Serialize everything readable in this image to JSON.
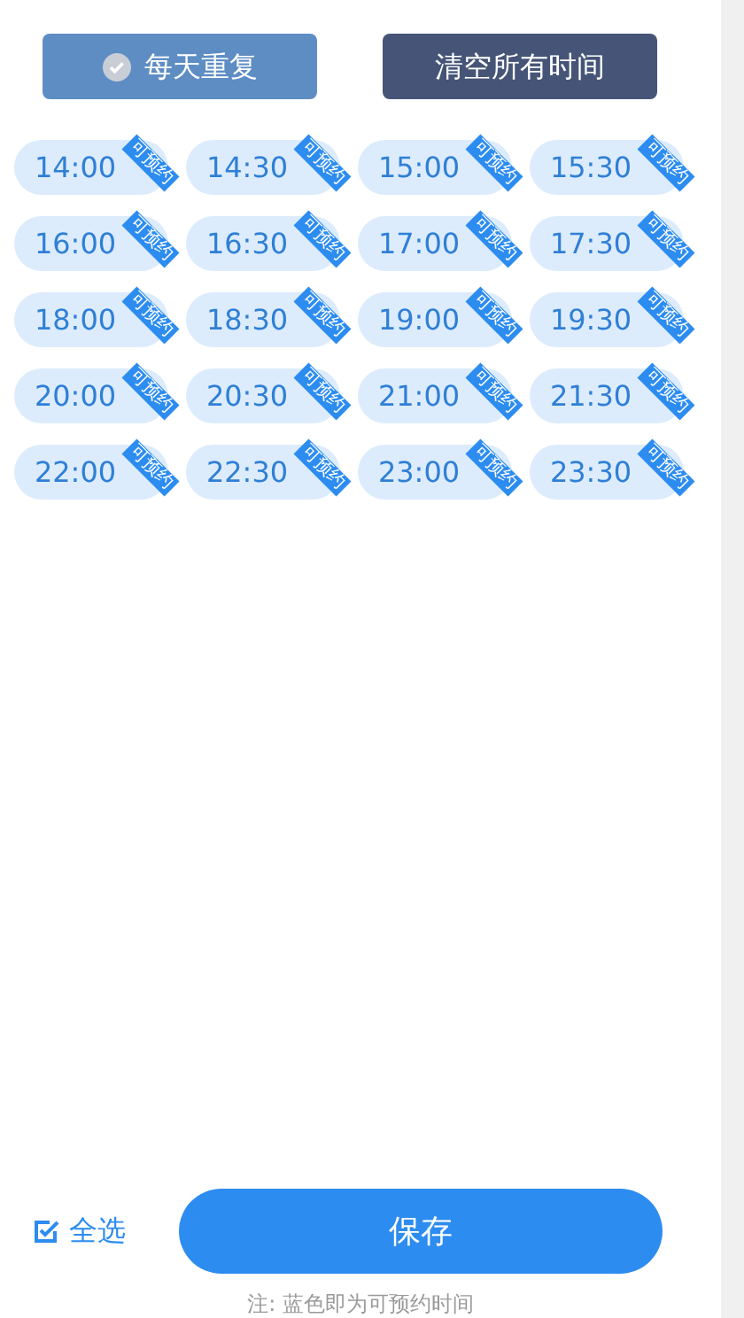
{
  "repeat_button": {
    "label": "每天重复",
    "checked": false
  },
  "clear_button": {
    "label": "清空所有时间"
  },
  "slots": [
    {
      "time": "14:00",
      "available": true,
      "badge": "可预约"
    },
    {
      "time": "14:30",
      "available": true,
      "badge": "可预约"
    },
    {
      "time": "15:00",
      "available": true,
      "badge": "可预约"
    },
    {
      "time": "15:30",
      "available": true,
      "badge": "可预约"
    },
    {
      "time": "16:00",
      "available": true,
      "badge": "可预约"
    },
    {
      "time": "16:30",
      "available": true,
      "badge": "可预约"
    },
    {
      "time": "17:00",
      "available": true,
      "badge": "可预约"
    },
    {
      "time": "17:30",
      "available": true,
      "badge": "可预约"
    },
    {
      "time": "18:00",
      "available": true,
      "badge": "可预约"
    },
    {
      "time": "18:30",
      "available": true,
      "badge": "可预约"
    },
    {
      "time": "19:00",
      "available": true,
      "badge": "可预约"
    },
    {
      "time": "19:30",
      "available": true,
      "badge": "可预约"
    },
    {
      "time": "20:00",
      "available": true,
      "badge": "可预约"
    },
    {
      "time": "20:30",
      "available": true,
      "badge": "可预约"
    },
    {
      "time": "21:00",
      "available": true,
      "badge": "可预约"
    },
    {
      "time": "21:30",
      "available": true,
      "badge": "可预约"
    },
    {
      "time": "22:00",
      "available": true,
      "badge": "可预约"
    },
    {
      "time": "22:30",
      "available": true,
      "badge": "可预约"
    },
    {
      "time": "23:00",
      "available": true,
      "badge": "可预约"
    },
    {
      "time": "23:30",
      "available": true,
      "badge": "可预约"
    }
  ],
  "select_all": {
    "label": "全选",
    "checked": true
  },
  "save_button": {
    "label": "保存"
  },
  "note": "注: 蓝色即为可预约时间"
}
